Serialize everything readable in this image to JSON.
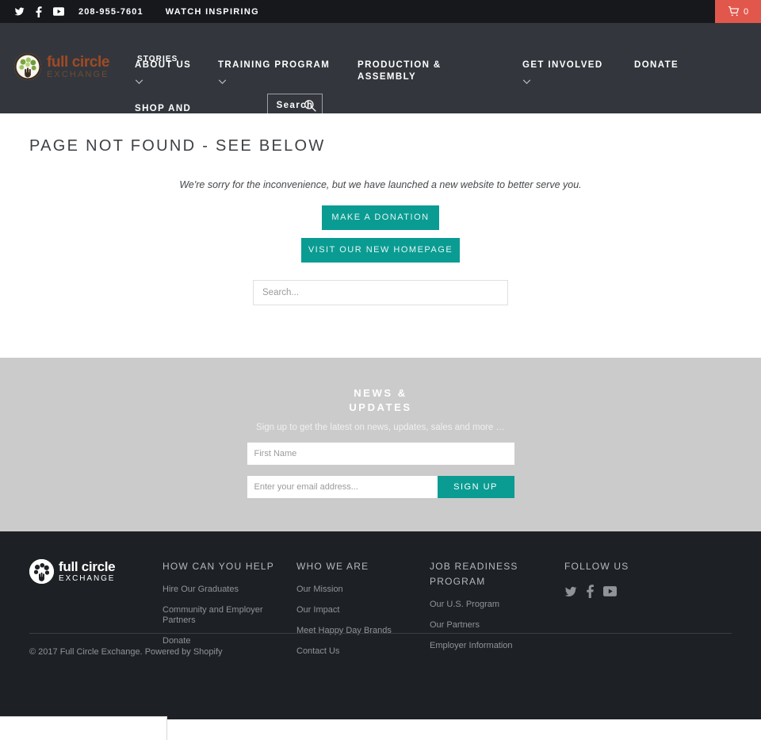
{
  "topbar": {
    "social": [
      {
        "name": "twitter-icon",
        "label": "Twitter"
      },
      {
        "name": "facebook-icon",
        "label": "Facebook"
      },
      {
        "name": "youtube-icon",
        "label": "YouTube"
      }
    ],
    "phone": "208-955-7601",
    "watch_link": "WATCH INSPIRING",
    "cart_count": "0",
    "cart_icon": "shopping-cart-icon",
    "background": "#16181c",
    "cart_background": "#e2574c"
  },
  "header": {
    "background": "#33373d",
    "logo": {
      "word1": "full circle",
      "word2": "EXCHANGE",
      "mark": "tree-hand-circle-icon",
      "word1_color": "#a14a24",
      "word2_color": "#6e4a33"
    },
    "nav": [
      {
        "label": "STORIES",
        "caret": false
      },
      {
        "label": "ABOUT US",
        "caret": true
      },
      {
        "label": "TRAINING PROGRAM",
        "caret": true
      },
      {
        "label": "PRODUCTION & ASSEMBLY",
        "caret": false
      },
      {
        "label": "GET INVOLVED",
        "caret": true
      },
      {
        "label": "DONATE",
        "caret": false
      },
      {
        "label": "SHOP AND EMPOWER",
        "caret": false
      }
    ],
    "search_button": {
      "label": "Search",
      "icon": "magnifier-icon"
    }
  },
  "main": {
    "title": "PAGE NOT FOUND - SEE BELOW",
    "apology": "We're sorry for the inconvenience, but we have launched a new website to better serve you.",
    "donation_button": "MAKE A DONATION",
    "homepage_button": "VISIT OUR NEW HOMEPAGE",
    "search_placeholder": "Search...",
    "search_value": "",
    "accent_color": "#0a9c92"
  },
  "newsletter": {
    "heading": "NEWS & UPDATES",
    "subtext": "Sign up to get the latest on news, updates, sales and more …",
    "first_name_placeholder": "First Name",
    "first_name_value": "",
    "email_placeholder": "Enter your email address...",
    "email_value": "",
    "signup_button": "SIGN UP",
    "background": "#cbcbcb"
  },
  "footer": {
    "background": "#1d2126",
    "logo": {
      "word1": "full circle",
      "word2": "EXCHANGE",
      "mark": "tree-hand-circle-icon"
    },
    "columns": [
      {
        "heading": "HOW CAN YOU HELP",
        "links": [
          "Hire Our Graduates",
          "Community and Employer Partners",
          "Donate"
        ]
      },
      {
        "heading": "WHO WE ARE",
        "links": [
          "Our Mission",
          "Our Impact",
          "Meet Happy Day Brands",
          "Contact Us"
        ]
      },
      {
        "heading": "JOB READINESS PROGRAM",
        "links": [
          "Our U.S. Program",
          "Our Partners",
          "Employer Information"
        ]
      }
    ],
    "follow": {
      "heading": "FOLLOW US",
      "social": [
        {
          "name": "twitter-icon",
          "label": "Twitter"
        },
        {
          "name": "facebook-icon",
          "label": "Facebook"
        },
        {
          "name": "youtube-icon",
          "label": "YouTube"
        }
      ]
    },
    "copyright_prefix": "© 2017 Full Circle Exchange. ",
    "powered_by": "Powered by Shopify"
  }
}
